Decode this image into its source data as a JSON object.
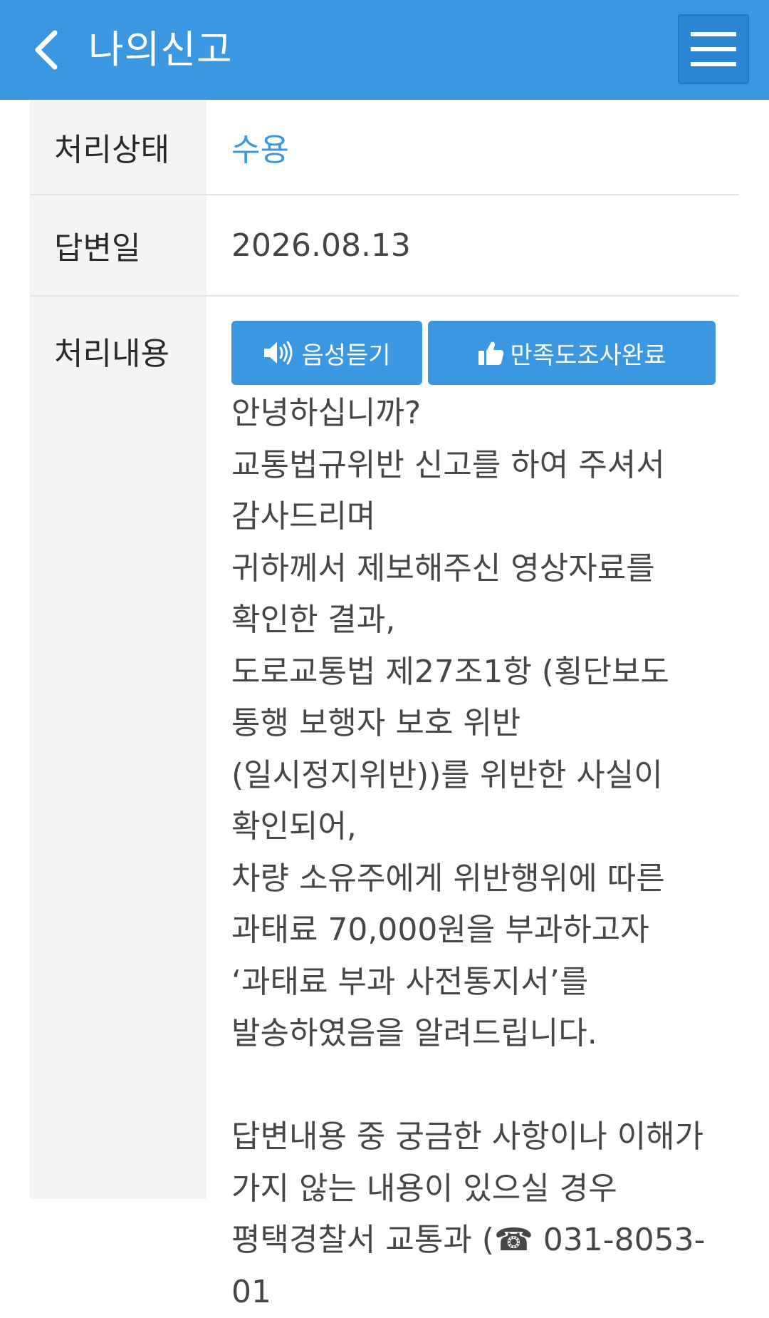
{
  "header": {
    "title": "나의신고"
  },
  "details": {
    "status_label": "처리상태",
    "status_value": "수용",
    "date_label": "답변일",
    "date_value": "2026.08.13",
    "content_label": "처리내용"
  },
  "buttons": {
    "voice_label": "음성듣기",
    "survey_label": "만족도조사완료"
  },
  "reply": {
    "body": "안녕하십니까?\n교통법규위반 신고를 하여 주셔서 감사드리며\n귀하께서 제보해주신 영상자료를 확인한 결과,\n도로교통법 제27조1항 (횡단보도 통행 보행자 보호 위반(일시정지위반))를 위반한 사실이 확인되어,\n차량 소유주에게 위반행위에 따른 과태료 70,000원을 부과하고자\n‘과태료 부과 사전통지서’를 발송하였음을 알려드립니다.\n\n답변내용 중 궁금한 사항이나 이해가 가지 않는 내용이 있으실 경우\n평택경찰서 교통과 (☎ 031-8053-01"
  },
  "colors": {
    "primary": "#3a97e0",
    "label_background": "#f4f4f4",
    "divider": "#e2e2e2"
  }
}
